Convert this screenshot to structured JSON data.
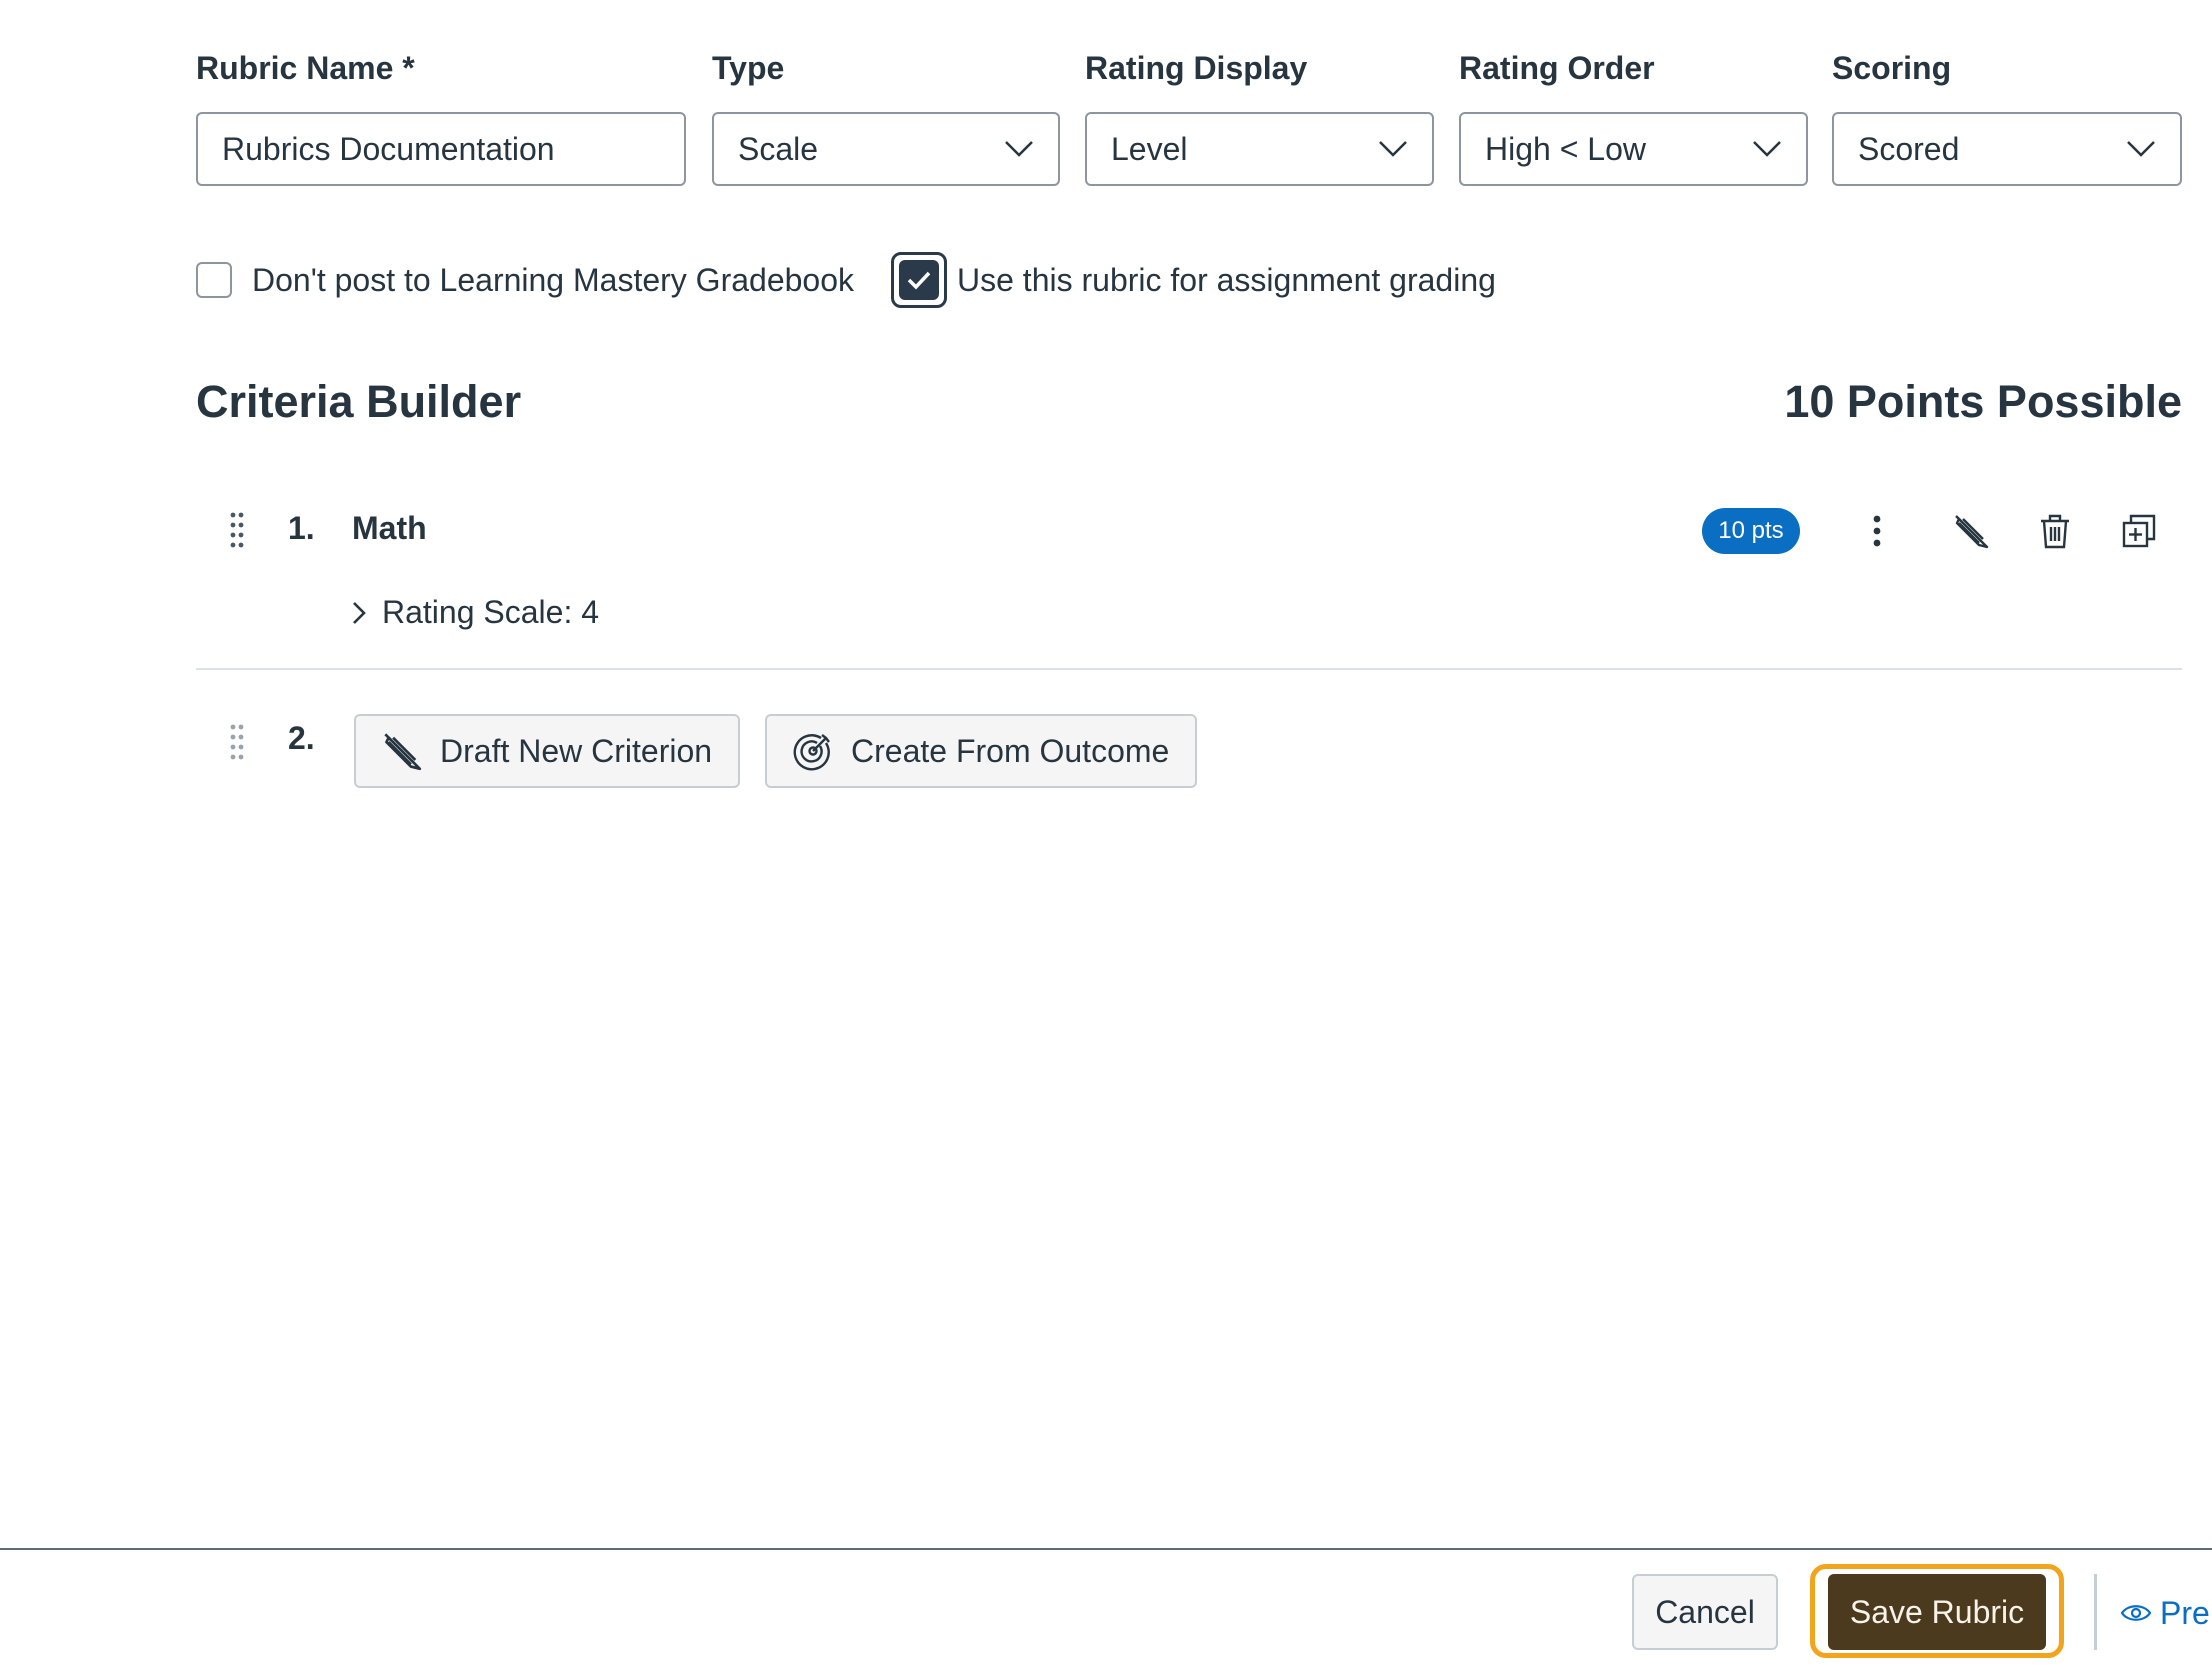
{
  "form": {
    "rubric_name_label": "Rubric Name *",
    "rubric_name_value": "Rubrics Documentation",
    "type_label": "Type",
    "type_value": "Scale",
    "rating_display_label": "Rating Display",
    "rating_display_value": "Level",
    "rating_order_label": "Rating Order",
    "rating_order_value": "High < Low",
    "scoring_label": "Scoring",
    "scoring_value": "Scored"
  },
  "options": {
    "dont_post_label": "Don't post to Learning Mastery Gradebook",
    "dont_post_checked": false,
    "use_for_grading_label": "Use this rubric for assignment grading",
    "use_for_grading_checked": true
  },
  "criteria_builder": {
    "title": "Criteria Builder",
    "points_possible": "10 Points Possible",
    "criteria": [
      {
        "number": "1.",
        "title": "Math",
        "points_badge": "10 pts",
        "rating_scale": "Rating Scale: 4"
      }
    ],
    "new_row": {
      "number": "2.",
      "draft_button": "Draft New Criterion",
      "outcome_button": "Create From Outcome"
    }
  },
  "footer": {
    "cancel": "Cancel",
    "save": "Save Rubric",
    "preview": "Pre"
  },
  "colors": {
    "accent_blue": "#0a6ec2",
    "save_button": "#4b3a1e",
    "focus_ring": "#f2a51c",
    "text": "#273540"
  },
  "icons": {
    "select_caret": "chevron-down-icon",
    "drag": "drag-handle-icon",
    "kebab": "kebab-menu-icon",
    "edit": "pencil-icon",
    "delete": "trash-icon",
    "duplicate": "duplicate-icon",
    "expand": "chevron-right-icon",
    "outcome": "target-icon",
    "preview": "eye-icon"
  }
}
